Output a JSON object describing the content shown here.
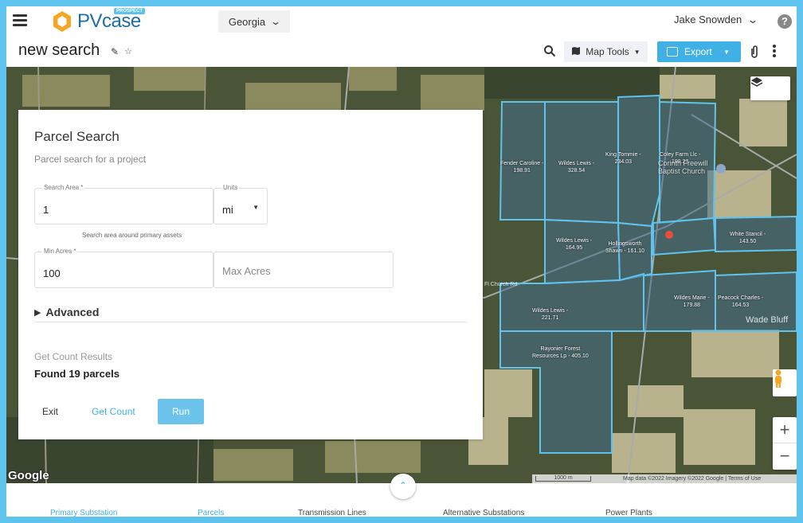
{
  "app": {
    "logo_text": "PVcase",
    "logo_badge": "PROSPECT"
  },
  "header": {
    "state": "Georgia",
    "user": "Jake Snowden",
    "help": "?"
  },
  "titlebar": {
    "title": "new search",
    "map_tools": "Map Tools",
    "export": "Export"
  },
  "panel": {
    "title": "Parcel Search",
    "subtitle": "Parcel search for a project",
    "search_area": {
      "label": "Search Area *",
      "value": "1"
    },
    "units": {
      "label": "Units",
      "value": "mi"
    },
    "search_hint": "Search area around primary assets",
    "min_acres": {
      "label": "Min Acres *",
      "value": "100"
    },
    "max_acres": {
      "placeholder": "Max Acres"
    },
    "advanced": "Advanced",
    "count_label": "Get Count Results",
    "count_result": "Found 19 parcels",
    "exit": "Exit",
    "get_count": "Get Count",
    "run": "Run"
  },
  "map": {
    "parcels": [
      {
        "name": "Fender Caroline -",
        "acres": "198.91"
      },
      {
        "name": "Wildes Lewis -",
        "acres": "328.54"
      },
      {
        "name": "King Tommie -",
        "acres": "234.03"
      },
      {
        "name": "Coley Farm Llc -",
        "acres": "199.23"
      },
      {
        "name": "Wildes Lewis -",
        "acres": "164.95"
      },
      {
        "name": "Hollingsworth",
        "acres": "Shawn - 161.10"
      },
      {
        "name": "White Stancil -",
        "acres": "143.50"
      },
      {
        "name": "Wildes Lewis -",
        "acres": "221.71"
      },
      {
        "name": "Wildes Marie -",
        "acres": "179.88"
      },
      {
        "name": "Peacock Charles -",
        "acres": "164.53"
      },
      {
        "name": "Rayonier Forest",
        "acres": "Resources Lp - 405.10"
      }
    ],
    "places": [
      "Corinth Freewill",
      "Baptist Church"
    ],
    "town": "Wade Bluff",
    "road": "Fl Church Rd",
    "google": "Google",
    "scale": "1000 m",
    "attribution": "Map data ©2022  Imagery ©2022 Google  |  Terms of Use"
  },
  "bottom_tabs": [
    "Primary Substation",
    "Parcels",
    "Transmission Lines",
    "Alternative Substations",
    "Power Plants"
  ],
  "colors": {
    "accent": "#3fb1e6",
    "parcel_stroke": "#5ec4ee",
    "frame": "#5ec4ee"
  }
}
